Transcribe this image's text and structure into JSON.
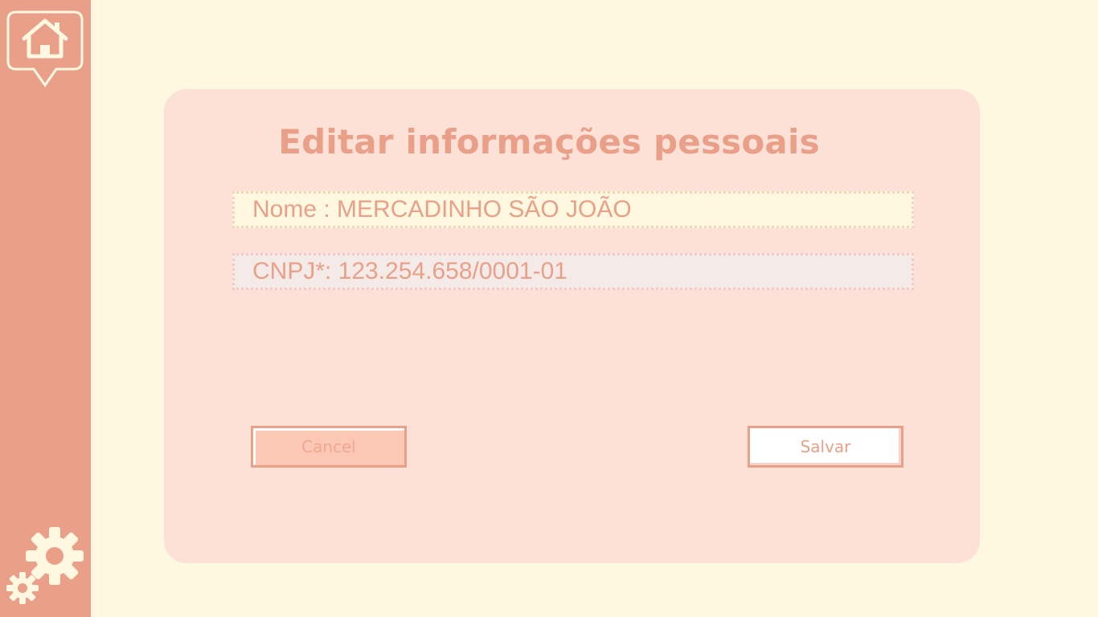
{
  "sidebar": {
    "home_icon": "home-icon",
    "settings_icon": "settings-gears-icon"
  },
  "form": {
    "title": "Editar informações pessoais",
    "name_field": "Nome : MERCADINHO SÃO JOÃO",
    "cnpj_field": "CNPJ*: 123.254.658/0001-01"
  },
  "buttons": {
    "cancel_label": "Cancel",
    "save_label": "Salvar"
  },
  "colors": {
    "accent": "#eaa088",
    "background": "#fff8e0",
    "card": "#fde0d6"
  }
}
